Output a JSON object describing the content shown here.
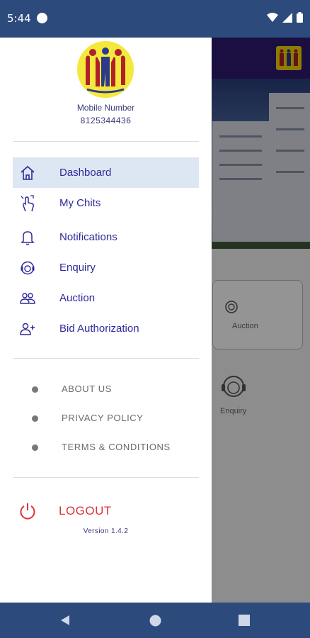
{
  "status_bar": {
    "time": "5:44"
  },
  "profile": {
    "mobile_label": "Mobile Number",
    "mobile_number": "8125344436"
  },
  "menu": {
    "items": [
      {
        "label": "Dashboard",
        "icon": "home-icon",
        "active": true
      },
      {
        "label": "My Chits",
        "icon": "hand-tap-icon",
        "active": false
      },
      {
        "label": "Notifications",
        "icon": "bell-icon",
        "active": false
      },
      {
        "label": "Enquiry",
        "icon": "headset-icon",
        "active": false
      },
      {
        "label": "Auction",
        "icon": "people-icon",
        "active": false
      },
      {
        "label": "Bid Authorization",
        "icon": "add-person-icon",
        "active": false
      }
    ]
  },
  "links": [
    {
      "label": "ABOUT US"
    },
    {
      "label": "PRIVACY POLICY"
    },
    {
      "label": "TERMS & CONDITIONS"
    }
  ],
  "logout": {
    "label": "LOGOUT",
    "icon": "power-icon"
  },
  "version": "Version  1.4.2",
  "background": {
    "auction_label": "Auction",
    "enquiry_label": "Enquiry"
  },
  "colors": {
    "primary": "#2c4a7c",
    "menu_text": "#2e2a9a",
    "active_bg": "#dde6f3",
    "logout": "#e0313a",
    "logo_yellow": "#f5e83c"
  }
}
